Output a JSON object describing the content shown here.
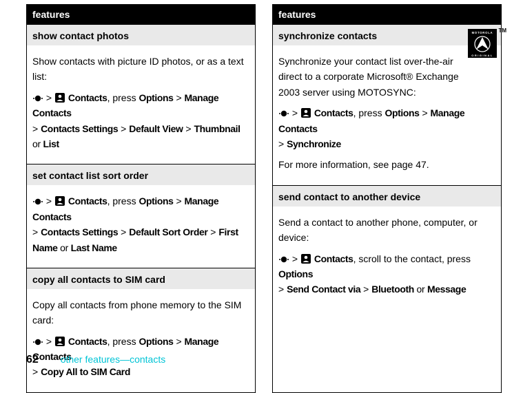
{
  "header_label": "features",
  "left": {
    "sections": [
      {
        "title": "show contact photos",
        "desc": "Show contacts with picture ID photos, or as a text list:",
        "path_app": "Contacts",
        "path_tail1": ", press ",
        "path_opts": "Options",
        "path_tail2": "Manage Contacts",
        "line2_a": "Contacts Settings",
        "line2_b": "Default View",
        "line2_c": "Thumbnail",
        "line2_or": " or ",
        "line2_d": "List"
      },
      {
        "title": "set contact list sort order",
        "path_app": "Contacts",
        "path_tail1": ", press ",
        "path_opts": "Options",
        "path_tail2": "Manage Contacts",
        "line2_a": "Contacts Settings",
        "line2_b": "Default Sort Order",
        "line2_c": "First Name",
        "line2_or": " or ",
        "line2_d": "Last Name"
      },
      {
        "title": "copy all contacts to SIM card",
        "desc": "Copy all contacts from phone memory to the SIM card:",
        "path_app": "Contacts",
        "path_tail1": ", press ",
        "path_opts": "Options",
        "path_tail2": "Manage Contacts",
        "line2_single": "Copy All to SIM Card"
      }
    ]
  },
  "right": {
    "sections": [
      {
        "title": "synchronize contacts",
        "desc": "Synchronize your contact list over-the-air direct to a corporate Microsoft® Exchange 2003 server using MOTOSYNC:",
        "path_app": "Contacts",
        "path_tail1": ", press ",
        "path_opts": "Options",
        "path_tail2": "Manage Contacts",
        "line2_single": "Synchronize",
        "note": "For more information, see page 47.",
        "badge_tm": "TM",
        "badge_brand": "MOTOROLA",
        "badge_sub": "O R I G I N A L"
      },
      {
        "title": "send contact to another device",
        "desc": "Send a contact to another phone, computer, or device:",
        "path_app": "Contacts",
        "path_mid": ", scroll to the contact, press ",
        "path_opts": "Options",
        "line2_a": "Send Contact via",
        "line2_b": "Bluetooth",
        "line2_or": " or ",
        "line2_c": "Message"
      }
    ]
  },
  "footer": {
    "page": "62",
    "crumb": "other features—contacts"
  }
}
